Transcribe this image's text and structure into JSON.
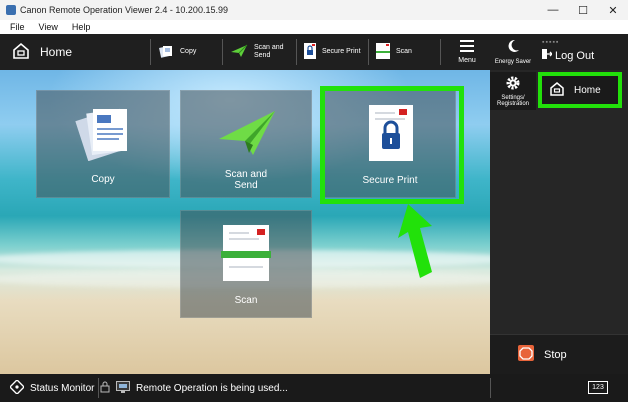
{
  "window": {
    "title": "Canon Remote Operation Viewer 2.4 - 10.200.15.99",
    "controls": {
      "minimize": "—",
      "maximize": "☐",
      "close": "✕"
    }
  },
  "menubar": {
    "items": [
      "File",
      "View",
      "Help"
    ]
  },
  "topbar": {
    "home_label": "Home",
    "quick_buttons": [
      {
        "label": "Copy",
        "icon": "copy-icon"
      },
      {
        "label": "Scan and\nSend",
        "icon": "scan-send-icon"
      },
      {
        "label": "Secure Print",
        "icon": "secure-print-icon"
      },
      {
        "label": "Scan",
        "icon": "scan-icon"
      }
    ],
    "menu_label": "Menu"
  },
  "right_panel": {
    "energy_saver": "Energy Saver",
    "user_name": "▪▪▪▪▪",
    "log_out": "Log Out",
    "settings": "Settings/\nRegistration",
    "home": "Home",
    "stop": "Stop"
  },
  "tiles": [
    {
      "label": "Copy",
      "icon": "copy-icon"
    },
    {
      "label": "Scan and\nSend",
      "icon": "scan-send-icon"
    },
    {
      "label": "Secure Print",
      "icon": "secure-print-icon"
    },
    {
      "label": "Scan",
      "icon": "scan-icon"
    }
  ],
  "status_bar": {
    "status_monitor": "Status Monitor",
    "message": "Remote Operation is being used...",
    "keypad": "123"
  },
  "colors": {
    "highlight": "#22e10a",
    "stop": "#e8643a",
    "dark": "#1f1f1f"
  }
}
